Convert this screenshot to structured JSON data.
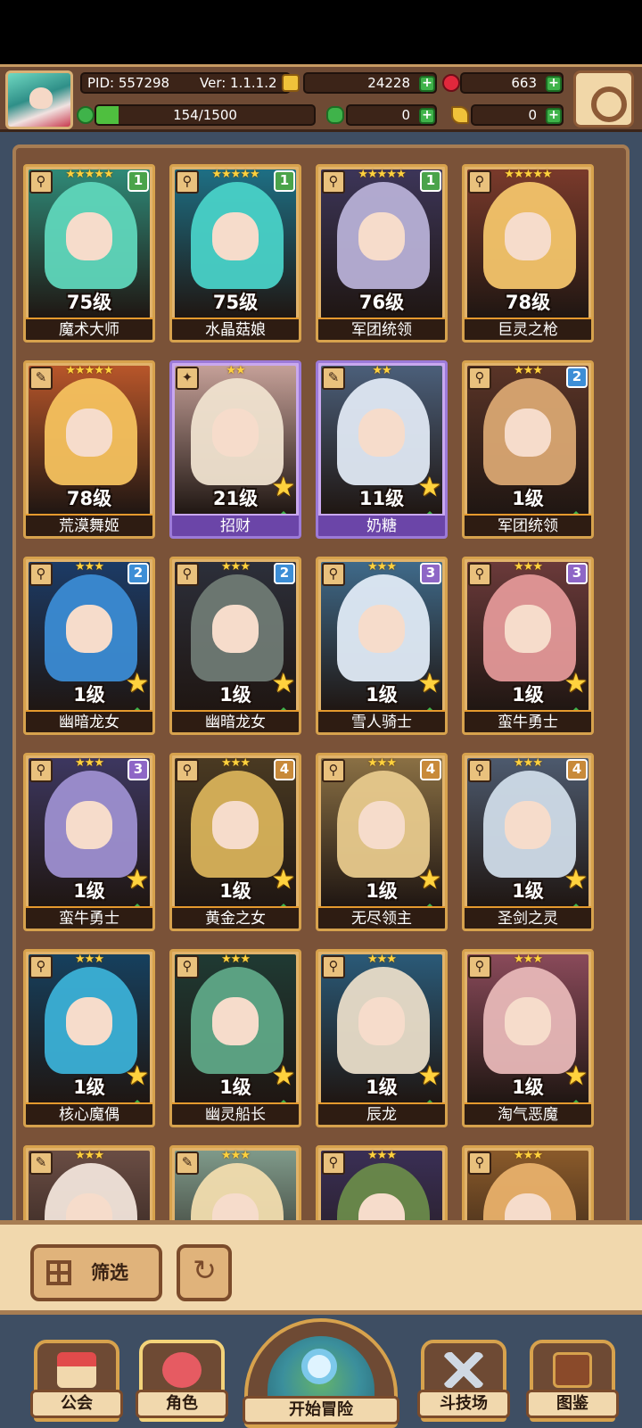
{
  "header": {
    "pid": "PID: 557298",
    "version": "Ver: 1.1.1.2",
    "gold": "24228",
    "gems": "663",
    "stamina": "154/1500",
    "clover": "0",
    "key": "0",
    "stamina_progress": 0.103
  },
  "heroes": [
    {
      "name": "魔术大师",
      "level": "75级",
      "stars": "★★★★★",
      "rank": "1",
      "class": "⚲",
      "palette": "#2f8a78",
      "skin": "#5fd6bb"
    },
    {
      "name": "水晶菇娘",
      "level": "75级",
      "stars": "★★★★★",
      "rank": "1",
      "class": "⚲",
      "palette": "#1e6f84",
      "skin": "#49d1c7"
    },
    {
      "name": "军团统领",
      "level": "76级",
      "stars": "★★★★★",
      "rank": "1",
      "class": "⚲",
      "palette": "#3c3558",
      "skin": "#b7b0d6"
    },
    {
      "name": "巨灵之枪",
      "level": "78级",
      "stars": "★★★★★",
      "rank": "",
      "class": "⚲",
      "palette": "#7a3a2b",
      "skin": "#f3c46a"
    },
    {
      "name": "荒漠舞姬",
      "level": "78级",
      "stars": "★★★★★",
      "rank": "",
      "class": "✎",
      "palette": "#b8562a",
      "skin": "#f4c15e"
    },
    {
      "name": "招财",
      "level": "21级",
      "stars": "★★",
      "rank": "",
      "class": "✦",
      "palette": "#c5a098",
      "skin": "#efe2cf",
      "epic": true
    },
    {
      "name": "奶糖",
      "level": "11级",
      "stars": "★★",
      "rank": "",
      "class": "✎",
      "palette": "#4b5f7a",
      "skin": "#dfe8f3",
      "epic": true
    },
    {
      "name": "军团统领",
      "level": "1级",
      "stars": "★★★",
      "rank": "2",
      "class": "⚲",
      "palette": "#5a3427",
      "skin": "#d9a772"
    },
    {
      "name": "幽暗龙女",
      "level": "1级",
      "stars": "★★★",
      "rank": "2",
      "class": "⚲",
      "palette": "#1c3b66",
      "skin": "#3b8bd3"
    },
    {
      "name": "幽暗龙女",
      "level": "1级",
      "stars": "★★★",
      "rank": "2",
      "class": "⚲",
      "palette": "#2c2f3a",
      "skin": "#6f7a74"
    },
    {
      "name": "雪人骑士",
      "level": "1级",
      "stars": "★★★",
      "rank": "3",
      "class": "⚲",
      "palette": "#3f6a8a",
      "skin": "#dfeaf5"
    },
    {
      "name": "蛮牛勇士",
      "level": "1级",
      "stars": "★★★",
      "rank": "3",
      "class": "⚲",
      "palette": "#6b3a3a",
      "skin": "#e39898"
    },
    {
      "name": "蛮牛勇士",
      "level": "1级",
      "stars": "★★★",
      "rank": "3",
      "class": "⚲",
      "palette": "#3d3760",
      "skin": "#9d8fd0"
    },
    {
      "name": "黄金之女",
      "level": "1级",
      "stars": "★★★",
      "rank": "4",
      "class": "⚲",
      "palette": "#4a3a22",
      "skin": "#d8b25a"
    },
    {
      "name": "无尽领主",
      "level": "1级",
      "stars": "★★★",
      "rank": "4",
      "class": "⚲",
      "palette": "#8a7044",
      "skin": "#e7c98c"
    },
    {
      "name": "圣剑之灵",
      "level": "1级",
      "stars": "★★★",
      "rank": "4",
      "class": "⚲",
      "palette": "#4d5a6e",
      "skin": "#cfdbe8"
    },
    {
      "name": "核心魔偶",
      "level": "1级",
      "stars": "★★★",
      "rank": "",
      "class": "⚲",
      "palette": "#16405e",
      "skin": "#3bb0d6"
    },
    {
      "name": "幽灵船长",
      "level": "1级",
      "stars": "★★★",
      "rank": "",
      "class": "⚲",
      "palette": "#1f3a33",
      "skin": "#5fa887"
    },
    {
      "name": "辰龙",
      "level": "1级",
      "stars": "★★★",
      "rank": "",
      "class": "⚲",
      "palette": "#2a5a78",
      "skin": "#e8dcc8"
    },
    {
      "name": "淘气恶魔",
      "level": "1级",
      "stars": "★★★",
      "rank": "",
      "class": "⚲",
      "palette": "#8a4a5a",
      "skin": "#e7b7b7"
    },
    {
      "name": "",
      "level": "",
      "stars": "★★★",
      "rank": "",
      "class": "✎",
      "palette": "#6a4d44",
      "skin": "#f1e4da"
    },
    {
      "name": "",
      "level": "",
      "stars": "★★★",
      "rank": "",
      "class": "✎",
      "palette": "#7f9a8a",
      "skin": "#f1dcae"
    },
    {
      "name": "",
      "level": "",
      "stars": "★★★",
      "rank": "",
      "class": "⚲",
      "palette": "#3a2f55",
      "skin": "#6a8a4a"
    },
    {
      "name": "",
      "level": "",
      "stars": "★★★",
      "rank": "",
      "class": "⚲",
      "palette": "#8a5a2a",
      "skin": "#e8b06a"
    }
  ],
  "card_flags": {
    "star_badge": [
      5,
      6,
      8,
      9,
      10,
      11,
      12,
      13,
      14,
      15,
      16,
      17,
      18,
      19
    ],
    "up_badge": [
      5,
      6,
      7,
      8,
      9,
      10,
      11,
      12,
      13,
      14,
      15,
      16,
      17,
      18,
      19
    ]
  },
  "filter": {
    "label": "筛选"
  },
  "nav": {
    "guild": "公会",
    "character": "角色",
    "adventure": "开始冒险",
    "arena": "斗技场",
    "codex": "图鉴"
  }
}
